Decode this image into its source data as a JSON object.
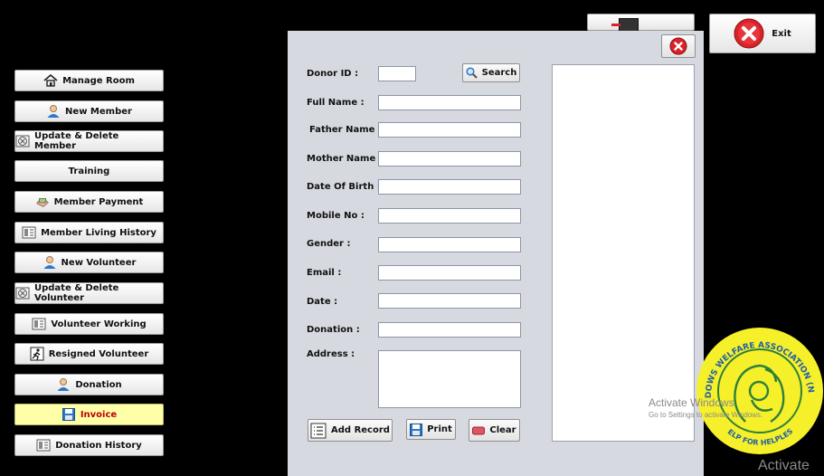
{
  "top_bar": {
    "exit_label": "Exit"
  },
  "sidebar": {
    "items": [
      {
        "label": "Manage Room",
        "icon": "home-icon"
      },
      {
        "label": "New Member",
        "icon": "user-icon"
      },
      {
        "label": "Update & Delete Member",
        "icon": "edit-record-icon"
      },
      {
        "label": "Training",
        "icon": ""
      },
      {
        "label": "Member Payment",
        "icon": "payment-icon"
      },
      {
        "label": "Member Living History",
        "icon": "history-icon"
      },
      {
        "label": "New Volunteer",
        "icon": "user-icon"
      },
      {
        "label": "Update & Delete Volunteer",
        "icon": "edit-record-icon"
      },
      {
        "label": "Volunteer Working",
        "icon": "history-icon"
      },
      {
        "label": "Resigned Volunteer",
        "icon": "exit-person-icon"
      },
      {
        "label": "Donation",
        "icon": "user-icon"
      },
      {
        "label": "Invoice",
        "icon": "save-icon",
        "active": true
      },
      {
        "label": "Donation History",
        "icon": "history-icon"
      }
    ]
  },
  "form": {
    "donor_id_label": "Donor ID :",
    "donor_id_value": "",
    "search_label": "Search",
    "full_name_label": "Full Name :",
    "father_name_label": "Father Name :",
    "mother_name_label": "Mother Name :",
    "dob_label": "Date Of Birth :",
    "mobile_label": "Mobile No :",
    "gender_label": "Gender :",
    "email_label": "Email :",
    "date_label": "Date :",
    "donation_label": "Donation :",
    "address_label": "Address :",
    "add_record_label": "Add Record",
    "print_label": "Print",
    "clear_label": "Clear"
  },
  "logo": {
    "top_text": "WIDOWS WELFARE ASSOCIATION (NGO)",
    "bottom_text": "HELP FOR HELPLESS"
  },
  "watermark": {
    "title": "Activate Windows",
    "subtitle": "Go to Settings to activate Windows.",
    "corner": "Activate"
  },
  "colors": {
    "background": "#000000",
    "panel": "#d6d9df",
    "active_button": "#ffffa8",
    "active_text": "#c00000",
    "logo_yellow": "#f5f02a",
    "logo_green": "#2f7f3a",
    "close_red": "#d8232a"
  }
}
